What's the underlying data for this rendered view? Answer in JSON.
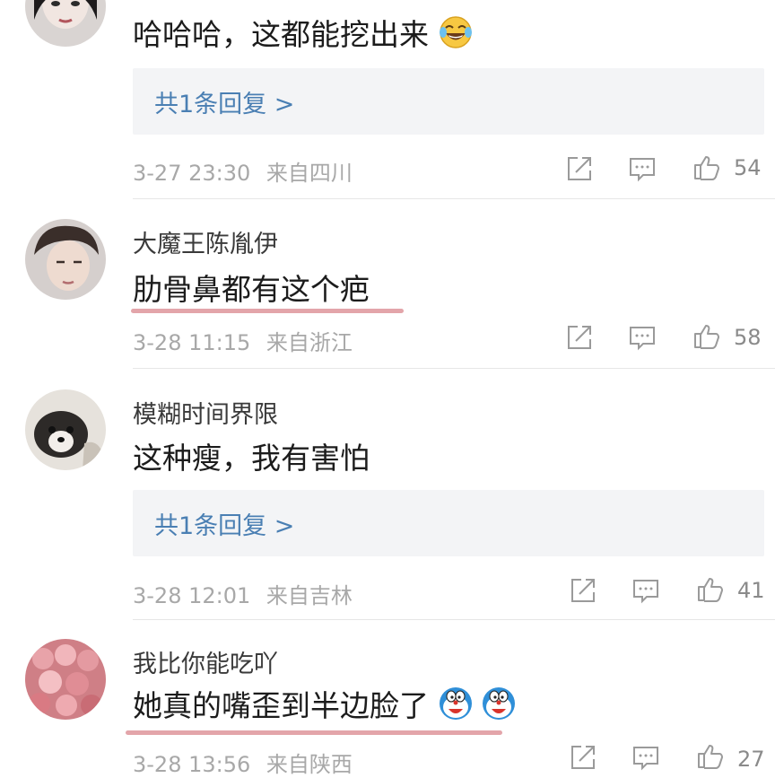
{
  "comments": [
    {
      "username": "",
      "text": "哈哈哈，这都能挖出来",
      "emoji": "laughing-tears-emoji",
      "reply_label": "共1条回复 >",
      "date": "3-27 23:30",
      "location": "来自四川",
      "likes": "54"
    },
    {
      "username": "大魔王陈胤伊",
      "text": "肋骨鼻都有这个疤",
      "date": "3-28 11:15",
      "location": "来自浙江",
      "likes": "58"
    },
    {
      "username": "模糊时间界限",
      "text": "这种瘦，我有害怕",
      "reply_label": "共1条回复 >",
      "date": "3-28 12:01",
      "location": "来自吉林",
      "likes": "41"
    },
    {
      "username": "我比你能吃吖",
      "text": "她真的嘴歪到半边脸了",
      "emoji": "doraemon-face-emoji",
      "date": "3-28 13:56",
      "location": "来自陕西",
      "likes": "27"
    }
  ],
  "icons": {
    "share": "share-icon",
    "comment": "comment-icon",
    "like": "thumbs-up-icon"
  },
  "colors": {
    "reply_link": "#4a7fb3",
    "meta_text": "#a8a8a8",
    "underline_mark": "#e3a5aa",
    "reply_box_bg": "#f3f4f6"
  }
}
